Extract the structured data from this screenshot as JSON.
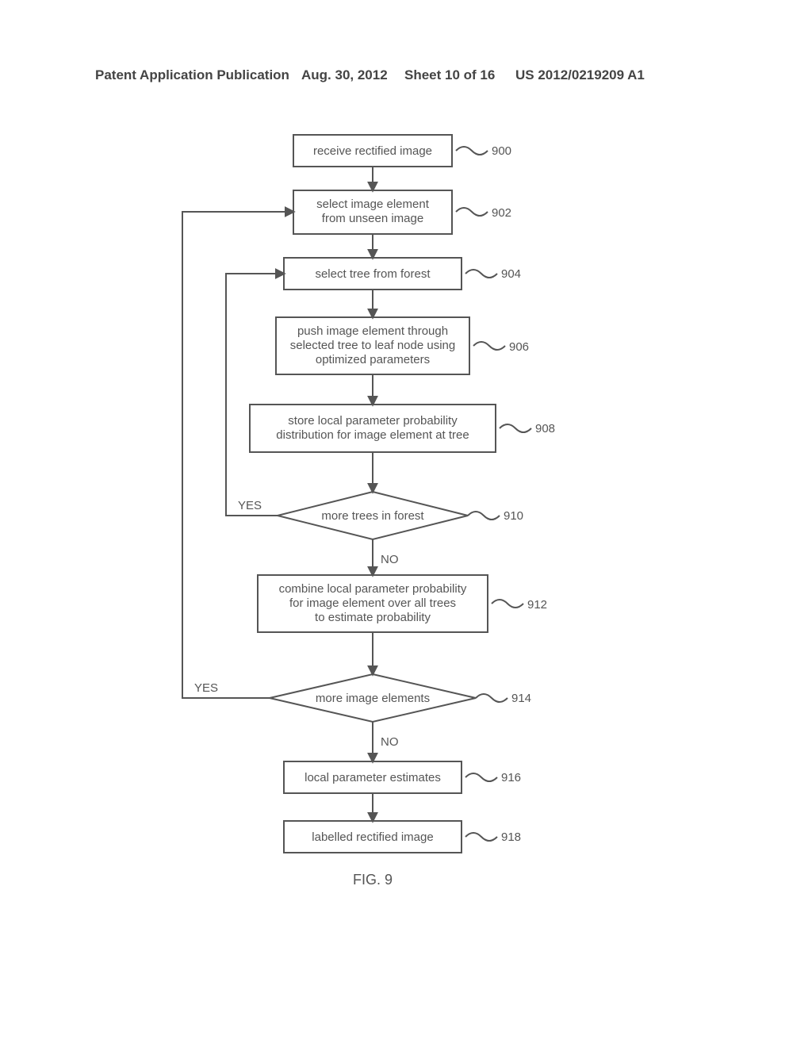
{
  "header": {
    "left": "Patent Application Publication",
    "date": "Aug. 30, 2012",
    "sheet": "Sheet 10 of 16",
    "pubno": "US 2012/0219209 A1"
  },
  "chart_data": {
    "type": "flowchart",
    "figure_label": "FIG. 9",
    "nodes": [
      {
        "id": "900",
        "shape": "rect",
        "text": [
          "receive rectified image"
        ],
        "ref": "900"
      },
      {
        "id": "902",
        "shape": "rect",
        "text": [
          "select image element",
          "from unseen image"
        ],
        "ref": "902"
      },
      {
        "id": "904",
        "shape": "rect",
        "text": [
          "select tree from forest"
        ],
        "ref": "904"
      },
      {
        "id": "906",
        "shape": "rect",
        "text": [
          "push image element through",
          "selected tree to leaf node using",
          "optimized parameters"
        ],
        "ref": "906"
      },
      {
        "id": "908",
        "shape": "rect",
        "text": [
          "store local parameter probability",
          "distribution for image element at tree"
        ],
        "ref": "908"
      },
      {
        "id": "910",
        "shape": "diamond",
        "text": [
          "more trees in forest"
        ],
        "ref": "910"
      },
      {
        "id": "912",
        "shape": "rect",
        "text": [
          "combine local parameter probability",
          "for image element over all trees",
          "to estimate probability"
        ],
        "ref": "912"
      },
      {
        "id": "914",
        "shape": "diamond",
        "text": [
          "more image elements"
        ],
        "ref": "914"
      },
      {
        "id": "916",
        "shape": "rect",
        "text": [
          "local parameter estimates"
        ],
        "ref": "916"
      },
      {
        "id": "918",
        "shape": "rect",
        "text": [
          "labelled rectified image"
        ],
        "ref": "918"
      }
    ],
    "edges": [
      {
        "from": "900",
        "to": "902"
      },
      {
        "from": "902",
        "to": "904"
      },
      {
        "from": "904",
        "to": "906"
      },
      {
        "from": "906",
        "to": "908"
      },
      {
        "from": "908",
        "to": "910"
      },
      {
        "from": "910",
        "to": "904",
        "label": "YES"
      },
      {
        "from": "910",
        "to": "912",
        "label": "NO"
      },
      {
        "from": "912",
        "to": "914"
      },
      {
        "from": "914",
        "to": "902",
        "label": "YES"
      },
      {
        "from": "914",
        "to": "916",
        "label": "NO"
      },
      {
        "from": "916",
        "to": "918"
      }
    ],
    "edge_labels": {
      "yes": "YES",
      "no": "NO"
    }
  }
}
